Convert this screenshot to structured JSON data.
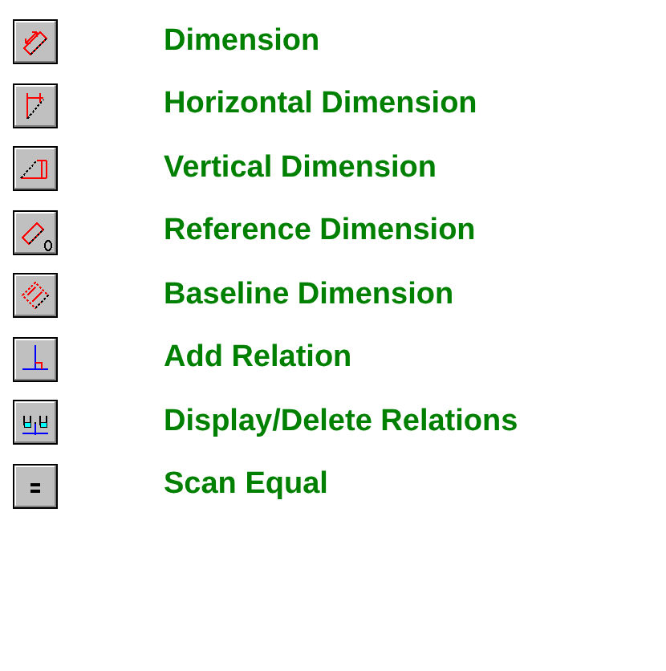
{
  "items": [
    {
      "label": "Dimension"
    },
    {
      "label": "Horizontal Dimension"
    },
    {
      "label": "Vertical Dimension"
    },
    {
      "label": "Reference Dimension"
    },
    {
      "label": "Baseline Dimension"
    },
    {
      "label": "Add Relation"
    },
    {
      "label": "Display/Delete Relations"
    },
    {
      "label": "Scan Equal"
    }
  ]
}
